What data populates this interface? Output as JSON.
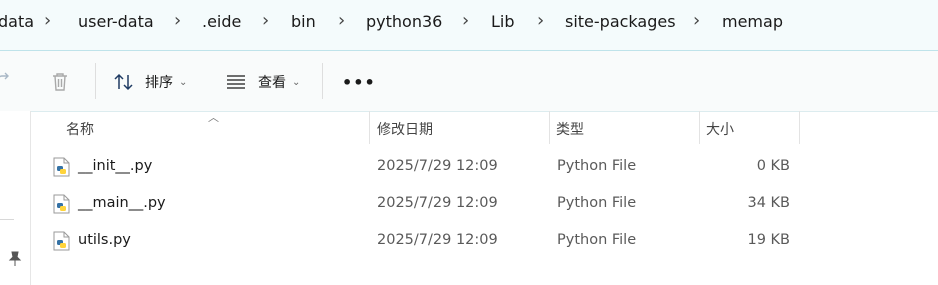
{
  "breadcrumb": {
    "items": [
      "data",
      "user-data",
      ".eide",
      "bin",
      "python36",
      "Lib",
      "site-packages",
      "memap"
    ]
  },
  "commandbar": {
    "sort_label": "排序",
    "view_label": "查看",
    "more_label": "•••"
  },
  "columns": {
    "name": "名称",
    "date": "修改日期",
    "type": "类型",
    "size": "大小"
  },
  "files": [
    {
      "name": "__init__.py",
      "date": "2025/7/29 12:09",
      "type": "Python File",
      "size": "0 KB"
    },
    {
      "name": "__main__.py",
      "date": "2025/7/29 12:09",
      "type": "Python File",
      "size": "34 KB"
    },
    {
      "name": "utils.py",
      "date": "2025/7/29 12:09",
      "type": "Python File",
      "size": "19 KB"
    }
  ],
  "icons": {
    "file": "python-file-icon",
    "sort": "sort-arrows-icon",
    "view": "view-lines-icon",
    "delete": "trash-icon",
    "share": "share-icon",
    "pin": "pin-icon"
  },
  "colors": {
    "address_bg": "#f4fbfc",
    "accent": "#0067c0",
    "python_blue": "#3572a5",
    "python_yellow": "#ffd43b"
  }
}
